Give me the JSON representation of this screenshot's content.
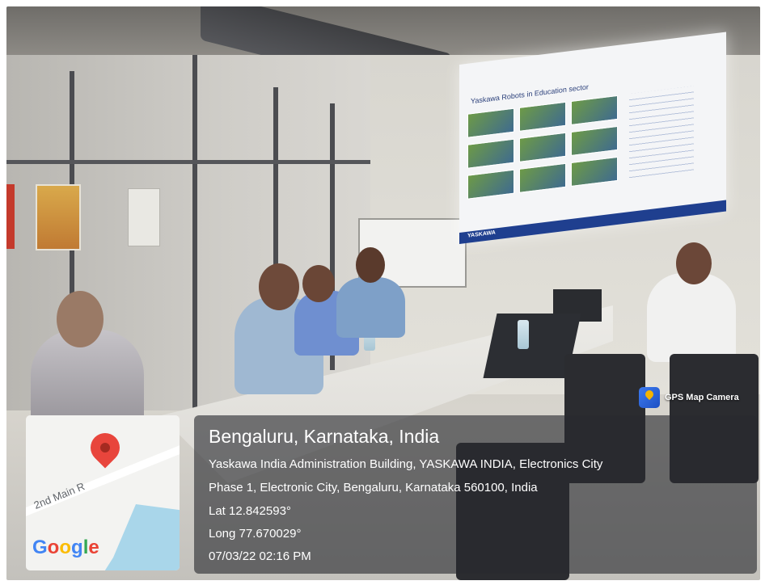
{
  "badge": {
    "label": "GPS Map Camera",
    "icon": "gps-map-camera-icon"
  },
  "location": {
    "city": "Bengaluru, Karnataka, India",
    "address_line1": "Yaskawa India Administration Building, YASKAWA INDIA, Electronics City",
    "address_line2": "Phase 1, Electronic City, Bengaluru, Karnataka 560100, India",
    "lat": "Lat 12.842593°",
    "long": "Long 77.670029°",
    "datetime": "07/03/22 02:16 PM"
  },
  "map": {
    "street_label": "2nd Main R",
    "logo_text": "Google",
    "pin_icon": "map-pin-icon",
    "colors": {
      "pin": "#e8453c",
      "water": "#a9d6ea"
    }
  },
  "slide": {
    "title": "Yaskawa Robots in Education sector",
    "brand": "YASKAWA"
  },
  "colors": {
    "panel_bg": "rgba(40,42,46,0.62)",
    "text": "#ffffff",
    "slide_footer": "#1f3f8f"
  }
}
